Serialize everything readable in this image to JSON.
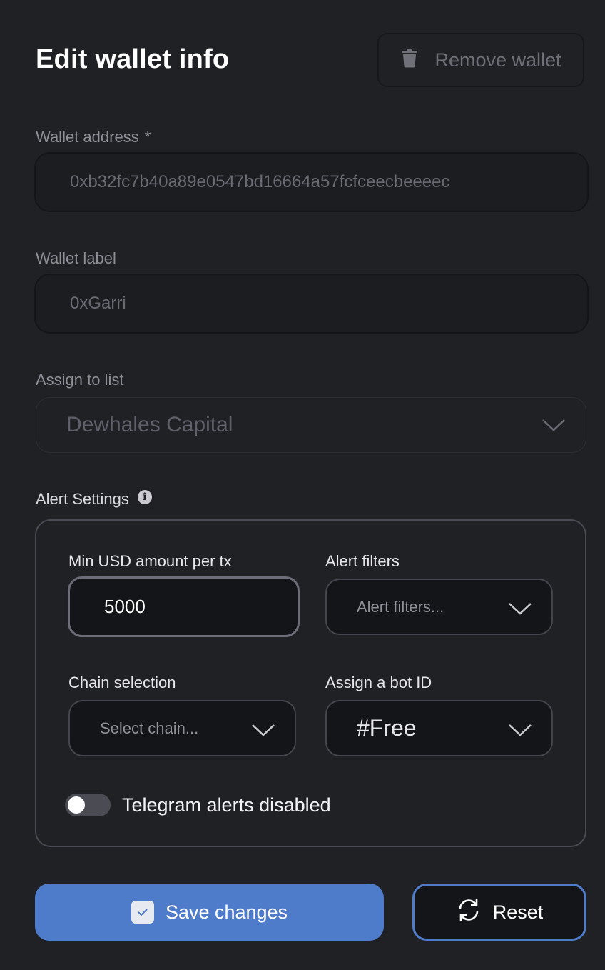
{
  "header": {
    "title": "Edit wallet info",
    "remove_label": "Remove wallet",
    "remove_icon": "trash-icon"
  },
  "wallet_address": {
    "label": "Wallet address",
    "required_mark": "*",
    "value": "0xb32fc7b40a89e0547bd16664a57fcfceecbeeeec"
  },
  "wallet_label": {
    "label": "Wallet label",
    "value": "0xGarri"
  },
  "assign_list": {
    "label": "Assign to list",
    "selected": "Dewhales Capital"
  },
  "alert_settings": {
    "title": "Alert Settings",
    "info_icon": "info-icon",
    "min_usd": {
      "label": "Min USD amount per tx",
      "value": "5000"
    },
    "alert_filters": {
      "label": "Alert filters",
      "placeholder": "Alert filters..."
    },
    "chain": {
      "label": "Chain selection",
      "placeholder": "Select chain..."
    },
    "bot_id": {
      "label": "Assign a bot ID",
      "selected": "#Free"
    },
    "telegram": {
      "label": "Telegram alerts disabled",
      "enabled": false
    }
  },
  "actions": {
    "save_label": "Save changes",
    "reset_label": "Reset"
  },
  "colors": {
    "background": "#202125",
    "accent": "#4e7ccb",
    "input_bg": "#141518"
  }
}
